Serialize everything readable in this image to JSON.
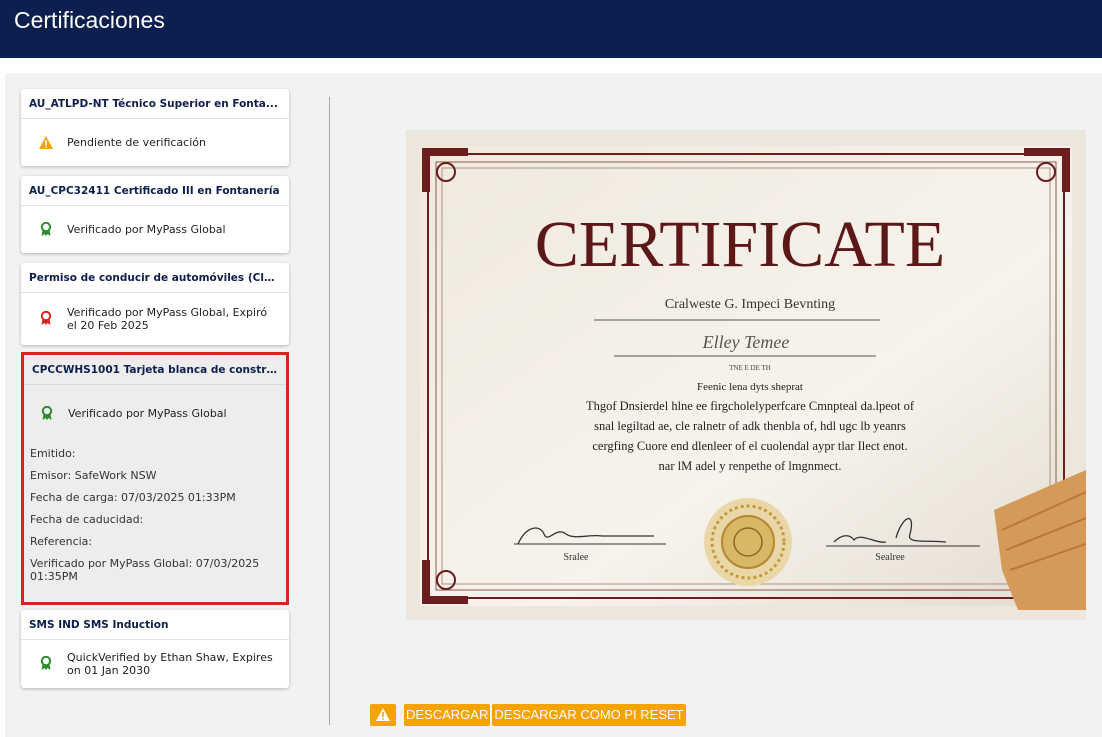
{
  "header": {
    "title": "Certificaciones"
  },
  "cards": [
    {
      "title": "AU_ATLPD-NT Técnico Superior en Fonta...",
      "status": "Pendiente de verificación"
    },
    {
      "title": "AU_CPC32411 Certificado III en Fontanería",
      "status": "Verificado por MyPass Global"
    },
    {
      "title": "Permiso de conducir de automóviles (Clas...",
      "status": "Verificado por MyPass Global, Expiró el 20 Feb 2025"
    },
    {
      "title": "CPCCWHS1001 Tarjeta blanca de construc...",
      "status": "Verificado por MyPass Global",
      "details": {
        "emitido": "Emitido:",
        "emisor": "Emisor: SafeWork NSW",
        "fecha_carga": "Fecha de carga: 07/03/2025 01:33PM",
        "fecha_caducidad": "Fecha de caducidad:",
        "referencia": "Referencia:",
        "verificado": "Verificado por MyPass Global: 07/03/2025 01:35PM"
      }
    },
    {
      "title": "SMS IND SMS Induction",
      "status": "QuickVerified by Ethan Shaw, Expires on 01 Jan 2030"
    }
  ],
  "certificate": {
    "heading": "CERTIFICATE",
    "subtitle": "Cralweste G. Impeci Bevnting",
    "name": "Elley Temee",
    "date_line": "TNE E DE TH",
    "body_1": "Feenic lena dyts sheprat",
    "body_2": "Thgof Dnsierdel hlne ee firgcholelyperfcare Cmnpteal da.lpeot of",
    "body_3": "snal legiltad ae, cle ralnetr of adk thenbla of, hdl ugc lb yeanrs",
    "body_4": "cergfing Cuore end dlenleer of el cuolendal aypr tlar Ilect enot.",
    "body_5": "nar lM adel y renpethe of lmgnmect.",
    "sign_left_label": "Sralee",
    "sign_right_label": "Sealree"
  },
  "toolbar": {
    "download": "DESCARGAR",
    "download_as": "DESCARGAR COMO PI RESET"
  },
  "colors": {
    "header_bg": "#0c1f4e",
    "accent_orange": "#f5a300",
    "verified_green": "#2e8b2e",
    "expired_red": "#d9231d",
    "selection_border": "#d9231d",
    "certificate_burgundy": "#6b1e1e"
  },
  "icons": {
    "pending": "warning-icon",
    "verified": "verified-badge-icon",
    "expired": "expired-badge-icon"
  }
}
